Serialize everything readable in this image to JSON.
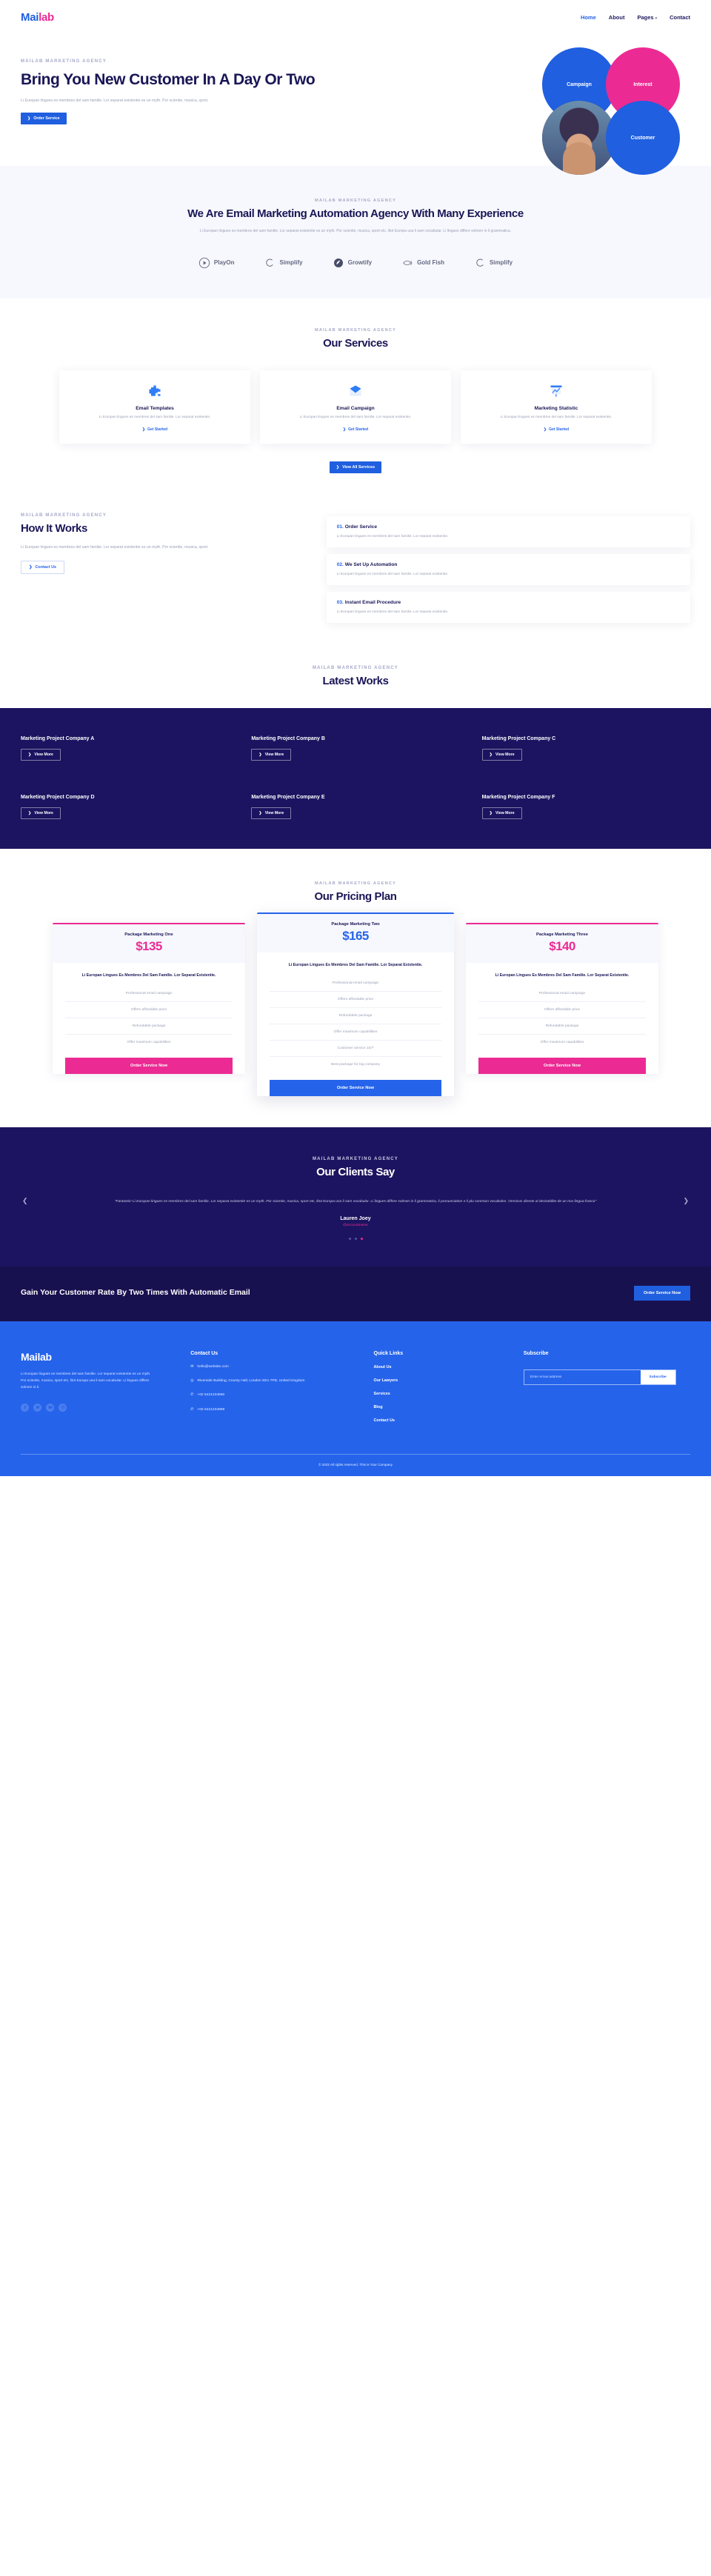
{
  "brand": {
    "name_part1": "Mai",
    "name_part2": "lab",
    "full": "Mailab"
  },
  "nav": {
    "links": [
      {
        "label": "Home",
        "active": true
      },
      {
        "label": "About",
        "active": false
      },
      {
        "label": "Pages",
        "active": false,
        "has_caret": true
      },
      {
        "label": "Contact",
        "active": false
      }
    ]
  },
  "hero": {
    "eyebrow": "MAILAB MARKETING AGENCY",
    "title": "Bring You New Customer In A Day Or Two",
    "paragraph": "Li Europan lingues es membres del sam familie. Lor separat existentie es un myth. Por scientie, musica, sport.",
    "cta_label": "Order Service",
    "circles": [
      {
        "label": "Campaign",
        "color": "#1f5fe0"
      },
      {
        "label": "Interest",
        "color": "#ec2a93"
      },
      {
        "label": "",
        "color": "#2a2254"
      },
      {
        "label": "Customer",
        "color": "#1f5fe0"
      }
    ]
  },
  "about": {
    "eyebrow": "MAILAB MARKETING AGENCY",
    "title": "We Are Email Marketing Automation Agency With Many Experience",
    "paragraph": "Li Europan lingues es membres del sam familie. Lor separat existentie es un myth. Por scientie, musica, sport etc, litot Europa usa li sam vocabular. Li lingues differe solmen in li grammatica.",
    "brands": [
      {
        "name": "PlayOn",
        "icon": "play-circle-icon"
      },
      {
        "name": "Simplify",
        "icon": "swirl-icon"
      },
      {
        "name": "Growtify",
        "icon": "leaf-circle-icon"
      },
      {
        "name": "Gold Fish",
        "icon": "fish-icon"
      },
      {
        "name": "Simplify",
        "icon": "swirl-icon"
      }
    ]
  },
  "services": {
    "eyebrow": "MAILAB MARKETING AGENCY",
    "title": "Our Services",
    "cards": [
      {
        "icon": "puzzle-icon",
        "name": "Email Templates",
        "desc": "Li Europan lingues es membres del sam familie. Lor separat existentie.",
        "link": "Get Started"
      },
      {
        "icon": "envelope-icon",
        "name": "Email Campaign",
        "desc": "Li Europan lingues es membres del sam familie. Lor separat existentie.",
        "link": "Get Started"
      },
      {
        "icon": "chart-board-icon",
        "name": "Marketing Statistic",
        "desc": "Li Europan lingues es membres del sam familie. Lor separat existentie.",
        "link": "Get Started"
      }
    ],
    "view_all_label": "View All Services"
  },
  "how": {
    "eyebrow": "MAILAB MARKETING AGENCY",
    "title": "How It Works",
    "paragraph": "Li Europan lingues es membres del sam familie. Lor separat existentie es un myth. Por scientie, musica, sport.",
    "cta_label": "Contact Us",
    "steps": [
      {
        "num": "01.",
        "title": "Order Service",
        "desc": "Li Europan lingues es membres del sam familie. Lor separat existentie."
      },
      {
        "num": "02.",
        "title": "We Set Up Automation",
        "desc": "Li Europan lingues es membres del sam familie. Lor separat existentie."
      },
      {
        "num": "03.",
        "title": "Instant Email Procedure",
        "desc": "Li Europan lingues es membres del sam familie. Lor separat existentie."
      }
    ]
  },
  "works": {
    "eyebrow": "MAILAB MARKETING AGENCY",
    "title": "Latest Works",
    "view_label": "View More",
    "items": [
      {
        "title": "Marketing Project Company A"
      },
      {
        "title": "Marketing Project Company B"
      },
      {
        "title": "Marketing Project Company C"
      },
      {
        "title": "Marketing Project Company D"
      },
      {
        "title": "Marketing Project Company E"
      },
      {
        "title": "Marketing Project Company F"
      }
    ]
  },
  "pricing": {
    "eyebrow": "MAILAB MARKETING AGENCY",
    "title": "Our Pricing Plan",
    "plans": [
      {
        "name": "Package Marketing One",
        "price": "$135",
        "accent": "#ec2a93",
        "featured": false,
        "lead": "Li Europan Lingues Es Membres Del Sam Familie. Lor Separat Existentie.",
        "features": [
          "Professional email campaign",
          "Offers affordable price",
          "Refundable package",
          "Offer maximum capabilities"
        ],
        "cta": "Order Service Now"
      },
      {
        "name": "Package Marketing Two",
        "price": "$165",
        "accent": "#2563eb",
        "featured": true,
        "lead": "Li Europan Lingues Es Membres Del Sam Familie. Lor Separat Existentie.",
        "features": [
          "Professional email campaign",
          "Offers affordable price",
          "Refundable package",
          "Offer maximum capabilities",
          "Customer service 24/7",
          "Best package for big company"
        ],
        "cta": "Order Service Now"
      },
      {
        "name": "Package Marketing Three",
        "price": "$140",
        "accent": "#ec2a93",
        "featured": false,
        "lead": "Li Europan Lingues Es Membres Del Sam Familie. Lor Separat Existentie.",
        "features": [
          "Professional email campaign",
          "Offers affordable price",
          "Refundable package",
          "Offer maximum capabilities"
        ],
        "cta": "Order Service Now"
      }
    ]
  },
  "testimonial": {
    "eyebrow": "MAILAB MARKETING AGENCY",
    "title": "Our Clients Say",
    "quote": "\"Fantastic! Li Europan lingues es membres del sam familie. Lor separat existentie es un myth. Por scientie, musica, sport etc, litot Europa usa li sam vocabular. Li lingues differe solmen in li grammatica, li pronunciation e li plu commun vocabules. Omnicos directe al desirabilite de un nov lingua franca\"",
    "author": "Lauren Joey",
    "handle": "@accountname",
    "prev_icon": "chevron-left-icon",
    "next_icon": "chevron-right-icon",
    "dots": 3,
    "active_dot": 3
  },
  "cta": {
    "title": "Gain Your Customer Rate By Two Times With Automatic Email",
    "button": "Order Service Now"
  },
  "footer": {
    "about": "Li Europan lingues es membres del sam familie. Lor separat existentie es un myth. Por scientie, musica, sport etc, litot Europa usa li sam vocabular. Li lingues differe solmen in li.",
    "socials": [
      "facebook-icon",
      "twitter-icon",
      "youtube-icon",
      "instagram-icon"
    ],
    "contact": {
      "heading": "Contact Us",
      "email": "hello@website.com",
      "address": "Riverside Building, County Hall, London SE1 7PB, United Kingdom",
      "phone1": "+02 5421234560",
      "phone2": "+02 5421234999"
    },
    "quick": {
      "heading": "Quick Links",
      "links": [
        "About Us",
        "Our Lawyers",
        "Services",
        "Blog",
        "Contact Us"
      ]
    },
    "subscribe": {
      "heading": "Subscribe",
      "placeholder": "Enter email address",
      "value": "",
      "button": "Subscribe"
    },
    "copyright": "© 2022 All rights reserved. This is Your Company"
  },
  "colors": {
    "blue": "#2563eb",
    "pink": "#ec2a93",
    "navy": "#1c1460",
    "deep": "#18114f"
  }
}
